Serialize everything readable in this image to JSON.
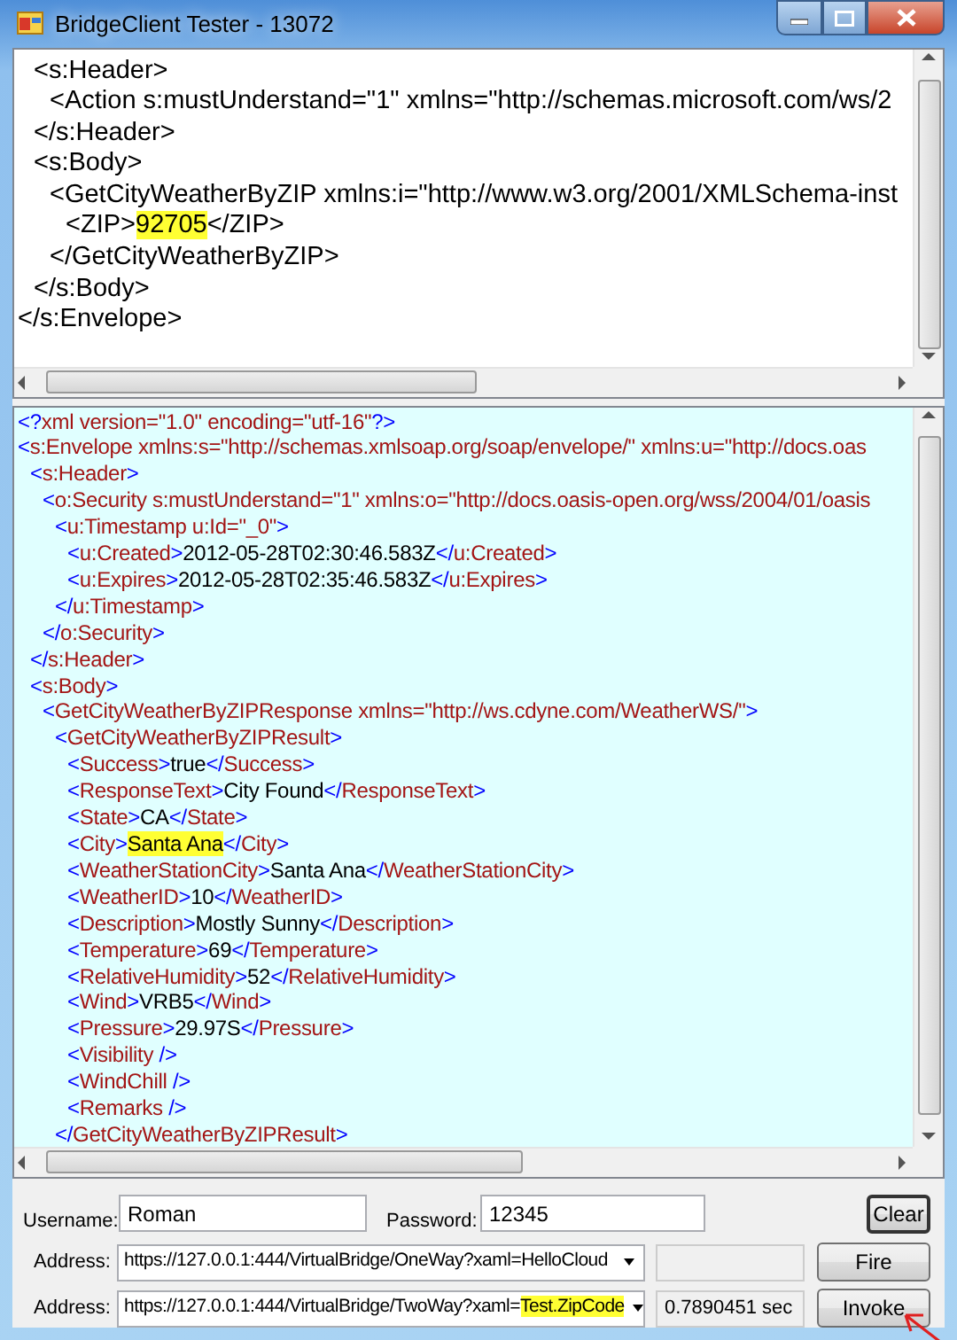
{
  "window": {
    "title": "BridgeClient Tester - 13072"
  },
  "request_pane": {
    "kind": "request",
    "lines": [
      {
        "children": [
          {
            "segments": [
              {
                "text": "<s:Header>",
                "highlighted": false
              }
            ],
            "children": [
              {
                "segments": [
                  {
                    "text": "<Action s:mustUnderstand=\"1\" xmlns=\"http://schemas.microsoft.com/ws/2",
                    "highlighted": false
                  }
                ]
              }
            ]
          },
          {
            "segments": [
              {
                "text": "</s:Header>",
                "highlighted": false
              }
            ]
          },
          {
            "segments": [
              {
                "text": "<s:Body>",
                "highlighted": false
              }
            ],
            "children": [
              {
                "segments": [
                  {
                    "text": "<GetCityWeatherByZIP xmlns:i=\"http://www.w3.org/2001/XMLSchema-inst",
                    "highlighted": false
                  }
                ],
                "children": [
                  {
                    "segments": [
                      {
                        "text": "<ZIP>",
                        "highlighted": false
                      },
                      {
                        "text": "92705",
                        "highlighted": true
                      },
                      {
                        "text": "</ZIP>",
                        "highlighted": false
                      }
                    ]
                  }
                ]
              },
              {
                "segments": [
                  {
                    "text": "</GetCityWeatherByZIP>",
                    "highlighted": false
                  }
                ]
              }
            ]
          },
          {
            "segments": [
              {
                "text": "</s:Body>",
                "highlighted": false
              }
            ]
          }
        ]
      },
      {
        "segments": [
          {
            "text": "</s:Envelope>",
            "highlighted": false
          }
        ]
      }
    ]
  },
  "response_pane": {
    "kind": "response",
    "lines": [
      {
        "segments": [
          {
            "text": "<?xml version=\"1.0\" encoding=\"utf-16\"?>",
            "highlighted": false
          }
        ]
      },
      {
        "segments": [
          {
            "text": "<s:Envelope xmlns:s=\"http://schemas.xmlsoap.org/soap/envelope/\" xmlns:u=\"http://docs.oas",
            "highlighted": false
          }
        ],
        "children": [
          {
            "segments": [
              {
                "text": "<s:Header>",
                "highlighted": false
              }
            ],
            "children": [
              {
                "segments": [
                  {
                    "text": "<o:Security s:mustUnderstand=\"1\" xmlns:o=\"http://docs.oasis-open.org/wss/2004/01/oasis",
                    "highlighted": false
                  }
                ],
                "children": [
                  {
                    "segments": [
                      {
                        "text": "<u:Timestamp u:Id=\"_0\">",
                        "highlighted": false
                      }
                    ],
                    "children": [
                      {
                        "segments": [
                          {
                            "text": "<u:Created>2012-05-28T02:30:46.583Z</u:Created>",
                            "highlighted": false
                          }
                        ]
                      },
                      {
                        "segments": [
                          {
                            "text": "<u:Expires>2012-05-28T02:35:46.583Z</u:Expires>",
                            "highlighted": false
                          }
                        ]
                      }
                    ]
                  },
                  {
                    "segments": [
                      {
                        "text": "</u:Timestamp>",
                        "highlighted": false
                      }
                    ]
                  }
                ]
              },
              {
                "segments": [
                  {
                    "text": "</o:Security>",
                    "highlighted": false
                  }
                ]
              }
            ]
          },
          {
            "segments": [
              {
                "text": "</s:Header>",
                "highlighted": false
              }
            ]
          },
          {
            "segments": [
              {
                "text": "<s:Body>",
                "highlighted": false
              }
            ],
            "children": [
              {
                "segments": [
                  {
                    "text": "<GetCityWeatherByZIPResponse xmlns=\"http://ws.cdyne.com/WeatherWS/\">",
                    "highlighted": false
                  }
                ],
                "children": [
                  {
                    "segments": [
                      {
                        "text": "<GetCityWeatherByZIPResult>",
                        "highlighted": false
                      }
                    ],
                    "children": [
                      {
                        "segments": [
                          {
                            "text": "<Success>true</Success>",
                            "highlighted": false
                          }
                        ]
                      },
                      {
                        "segments": [
                          {
                            "text": "<ResponseText>City Found</ResponseText>",
                            "highlighted": false
                          }
                        ]
                      },
                      {
                        "segments": [
                          {
                            "text": "<State>CA</State>",
                            "highlighted": false
                          }
                        ]
                      },
                      {
                        "segments": [
                          {
                            "text": "<City>",
                            "highlighted": false
                          },
                          {
                            "text": "Santa Ana",
                            "highlighted": true
                          },
                          {
                            "text": "</City>",
                            "highlighted": false
                          }
                        ]
                      },
                      {
                        "segments": [
                          {
                            "text": "<WeatherStationCity>Santa Ana</WeatherStationCity>",
                            "highlighted": false
                          }
                        ]
                      },
                      {
                        "segments": [
                          {
                            "text": "<WeatherID>10</WeatherID>",
                            "highlighted": false
                          }
                        ]
                      },
                      {
                        "segments": [
                          {
                            "text": "<Description>Mostly Sunny</Description>",
                            "highlighted": false
                          }
                        ]
                      },
                      {
                        "segments": [
                          {
                            "text": "<Temperature>69</Temperature>",
                            "highlighted": false
                          }
                        ]
                      },
                      {
                        "segments": [
                          {
                            "text": "<RelativeHumidity>52</RelativeHumidity>",
                            "highlighted": false
                          }
                        ]
                      },
                      {
                        "segments": [
                          {
                            "text": "<Wind>VRB5</Wind>",
                            "highlighted": false
                          }
                        ]
                      },
                      {
                        "segments": [
                          {
                            "text": "<Pressure>29.97S</Pressure>",
                            "highlighted": false
                          }
                        ]
                      },
                      {
                        "segments": [
                          {
                            "text": "<Visibility />",
                            "highlighted": false
                          }
                        ]
                      },
                      {
                        "segments": [
                          {
                            "text": "<WindChill />",
                            "highlighted": false
                          }
                        ]
                      },
                      {
                        "segments": [
                          {
                            "text": "<Remarks />",
                            "highlighted": false
                          }
                        ]
                      }
                    ]
                  },
                  {
                    "segments": [
                      {
                        "text": "</GetCityWeatherByZIPResult>",
                        "highlighted": false
                      }
                    ]
                  }
                ]
              }
            ]
          }
        ]
      }
    ]
  },
  "credentials": {
    "username_label": "Username:",
    "username": "Roman",
    "password_label": "Password:",
    "password": "12345"
  },
  "clear_button": {
    "label": "Clear",
    "focused": true
  },
  "address_rows": [
    {
      "label": "Address:",
      "segments": [
        {
          "text": "https://127.0.0.1:444/VirtualBridge/OneWay?xaml=HelloCloud",
          "highlighted": false
        }
      ],
      "button": {
        "label": "Fire",
        "focused": false
      }
    },
    {
      "label": "Address:",
      "segments": [
        {
          "text": "https://127.0.0.1:444/VirtualBridge/TwoWay?xaml=",
          "highlighted": false
        },
        {
          "text": "Test.ZipCode",
          "highlighted": true
        }
      ],
      "elapsed": "0.7890451 sec",
      "button": {
        "label": "Invoke",
        "focused": false
      }
    }
  ]
}
